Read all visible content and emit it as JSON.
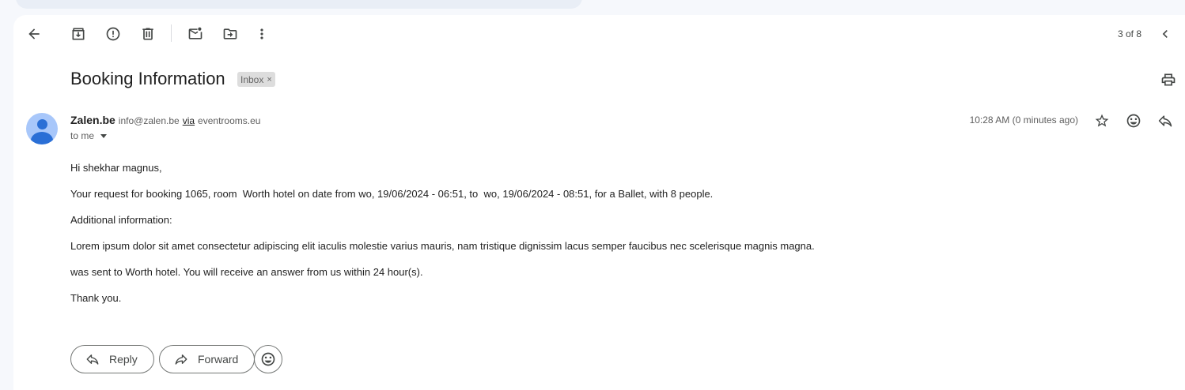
{
  "toolbar": {
    "back_icon": "arrow-left-icon",
    "archive_icon": "archive-icon",
    "spam_icon": "report-spam-icon",
    "delete_icon": "trash-icon",
    "mark_unread_icon": "mark-unread-icon",
    "move_icon": "move-to-folder-icon",
    "more_icon": "more-vert-icon",
    "counter": "3 of 8",
    "prev_icon": "chevron-left-icon"
  },
  "email": {
    "subject": "Booking Information",
    "label_chip": "Inbox",
    "label_remove": "×",
    "sender_name": "Zalen.be",
    "sender_email": "info@zalen.be",
    "via_label": "via",
    "via_domain": "eventrooms.eu",
    "recipient": "to me",
    "timestamp": "10:28 AM (0 minutes ago)",
    "body": [
      "Hi shekhar magnus,",
      "Your request for booking 1065, room  Worth hotel on date from wo, 19/06/2024 - 06:51, to  wo, 19/06/2024 - 08:51, for a Ballet, with 8 people.",
      "Additional information:",
      "Lorem ipsum dolor sit amet consectetur adipiscing elit iaculis molestie varius mauris, nam tristique dignissim lacus semper faucibus nec scelerisque magnis magna.",
      "was sent to Worth hotel. You will receive an answer from us within 24 hour(s).",
      "Thank you."
    ]
  },
  "actions": {
    "reply_label": "Reply",
    "forward_label": "Forward"
  },
  "colors": {
    "accent": "#2a6fd6",
    "avatar_bg": "#a8c7fa",
    "chip_bg": "#dddddd"
  }
}
